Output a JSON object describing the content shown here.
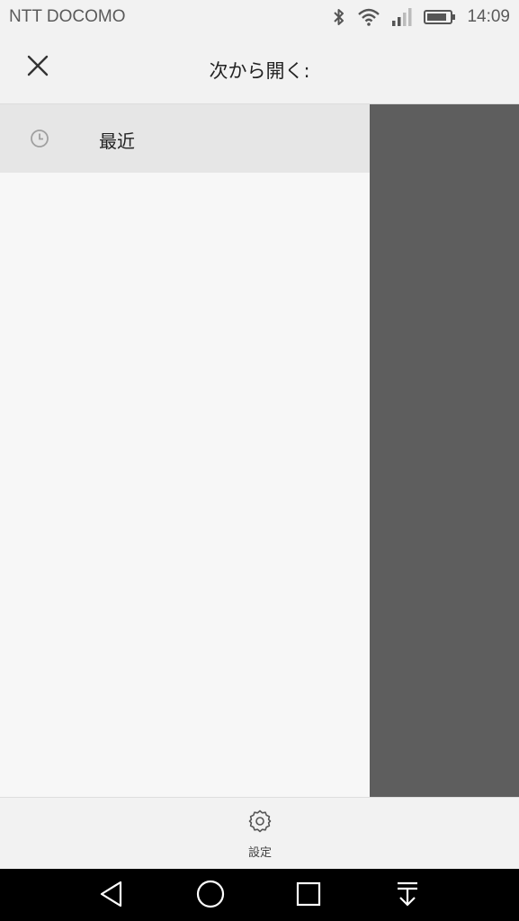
{
  "status_bar": {
    "carrier": "NTT DOCOMO",
    "time": "14:09",
    "icons": [
      "bluetooth-icon",
      "wifi-icon",
      "signal-icon",
      "battery-icon"
    ]
  },
  "header": {
    "title": "次から開く:",
    "close_icon": "close-icon"
  },
  "drawer": {
    "items": [
      {
        "label": "最近",
        "icon": "clock-icon"
      }
    ]
  },
  "bottom_bar": {
    "settings_label": "設定",
    "settings_icon": "gear-icon"
  },
  "nav_bar": {
    "buttons": [
      "back-icon",
      "home-icon",
      "recents-icon",
      "notification-pulldown-icon"
    ]
  },
  "colors": {
    "background": "#f2f2f2",
    "selected_item": "#e6e6e6",
    "overlay": "#5e5e5e",
    "nav_bar": "#000000"
  }
}
